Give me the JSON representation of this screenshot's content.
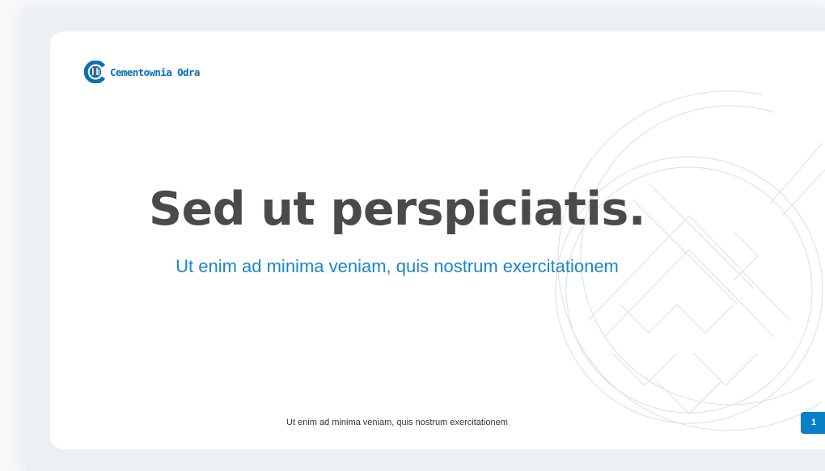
{
  "slide": {
    "logo": {
      "brand_name": "Cementownia Odra",
      "icon": "cementownia-odra-logo-icon",
      "brand_color": "#0a6fb3"
    },
    "title": "Sed ut perspiciatis.",
    "subtitle": "Ut enim ad minima veniam, quis nostrum exercitationem",
    "footer_text": "Ut enim ad minima veniam, quis nostrum exercitationem",
    "page_number": "1",
    "watermark_icon": "cementownia-logo-watermark",
    "colors": {
      "title": "#4a4a4a",
      "accent": "#1a86c8",
      "badge": "#0a7fc8",
      "background": "#edf0f3",
      "slide": "#ffffff"
    }
  }
}
